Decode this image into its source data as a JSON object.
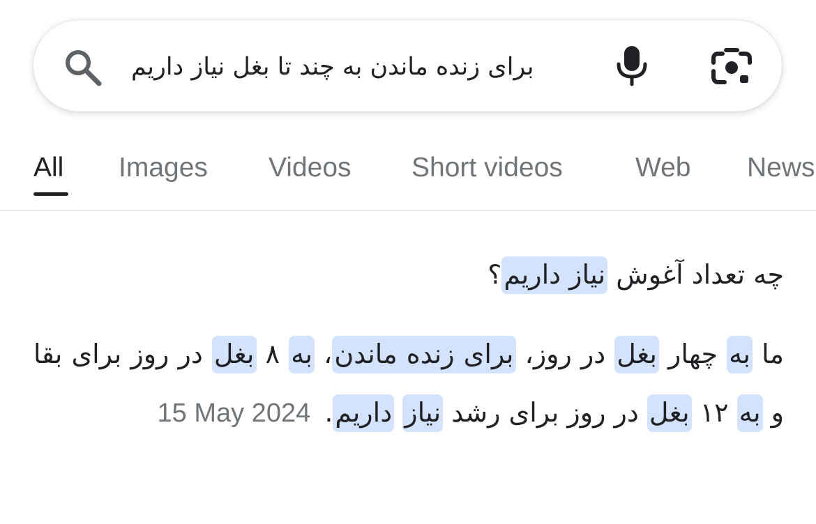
{
  "search": {
    "query": "برای زنده ماندن به چند تا بغل نیاز داریم",
    "icon": "search-icon",
    "mic_icon": "mic-icon",
    "lens_icon": "camera-lens-icon"
  },
  "tabs": [
    {
      "label": "All",
      "active": true
    },
    {
      "label": "Images",
      "active": false
    },
    {
      "label": "Videos",
      "active": false
    },
    {
      "label": "Short videos",
      "active": false
    },
    {
      "label": "Web",
      "active": false
    },
    {
      "label": "News",
      "active": false
    }
  ],
  "result": {
    "title_plain": "چه تعداد آغوش ",
    "title_highlight": "نیاز داریم",
    "title_end": "؟",
    "snippet": [
      {
        "t": "ما ",
        "h": false
      },
      {
        "t": "به",
        "h": true
      },
      {
        "t": " چهار ",
        "h": false
      },
      {
        "t": "بغل",
        "h": true
      },
      {
        "t": " در روز، ",
        "h": false
      },
      {
        "t": "برای زنده ماندن",
        "h": true
      },
      {
        "t": "، ",
        "h": false
      },
      {
        "t": "به",
        "h": true
      },
      {
        "t": " ۸ ",
        "h": false
      },
      {
        "t": "بغل",
        "h": true
      },
      {
        "t": " در روز برای بقا و ",
        "h": false
      },
      {
        "t": "به",
        "h": true
      },
      {
        "t": " ۱۲ ",
        "h": false
      },
      {
        "t": "بغل",
        "h": true
      },
      {
        "t": " در روز برای رشد ",
        "h": false
      },
      {
        "t": "نیاز",
        "h": true
      },
      {
        "t": " ",
        "h": false
      },
      {
        "t": "داریم",
        "h": true
      },
      {
        "t": ".",
        "h": false
      }
    ],
    "date": "15 May 2024"
  },
  "colors": {
    "highlight": "#d3e3fd",
    "text": "#202124",
    "muted": "#70757a"
  }
}
